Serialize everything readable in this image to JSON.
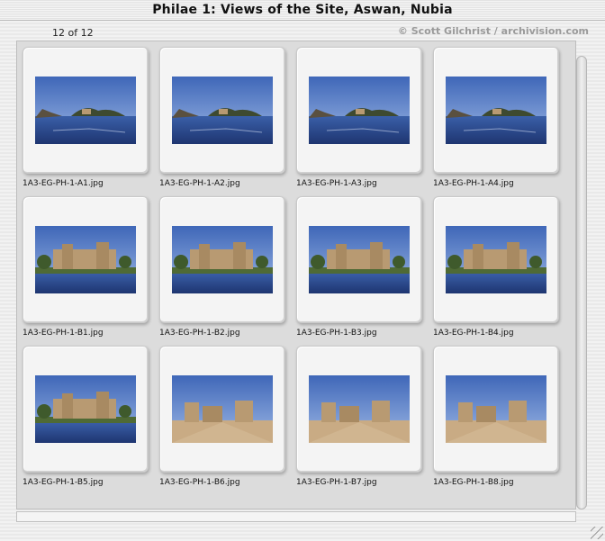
{
  "window": {
    "title": "Philae 1: Views of the Site, Aswan, Nubia"
  },
  "header": {
    "count": "12 of 12",
    "credit": "© Scott Gilchrist / archivision.com"
  },
  "slides": [
    {
      "caption": "1A3-EG-PH-1-A1.jpg",
      "scene": "water-island"
    },
    {
      "caption": "1A3-EG-PH-1-A2.jpg",
      "scene": "water-island"
    },
    {
      "caption": "1A3-EG-PH-1-A3.jpg",
      "scene": "water-island"
    },
    {
      "caption": "1A3-EG-PH-1-A4.jpg",
      "scene": "water-island"
    },
    {
      "caption": "1A3-EG-PH-1-B1.jpg",
      "scene": "temple-shore"
    },
    {
      "caption": "1A3-EG-PH-1-B2.jpg",
      "scene": "temple-shore"
    },
    {
      "caption": "1A3-EG-PH-1-B3.jpg",
      "scene": "temple-shore"
    },
    {
      "caption": "1A3-EG-PH-1-B4.jpg",
      "scene": "temple-shore"
    },
    {
      "caption": "1A3-EG-PH-1-B5.jpg",
      "scene": "temple-shore"
    },
    {
      "caption": "1A3-EG-PH-1-B6.jpg",
      "scene": "temple-ground"
    },
    {
      "caption": "1A3-EG-PH-1-B7.jpg",
      "scene": "temple-ground"
    },
    {
      "caption": "1A3-EG-PH-1-B8.jpg",
      "scene": "temple-ground"
    }
  ],
  "colors": {
    "sky": "#6f95d6",
    "water": "#2a4a8a",
    "stone": "#b89a72",
    "ground": "#c9ab84",
    "vegetation": "#4f6a35"
  }
}
